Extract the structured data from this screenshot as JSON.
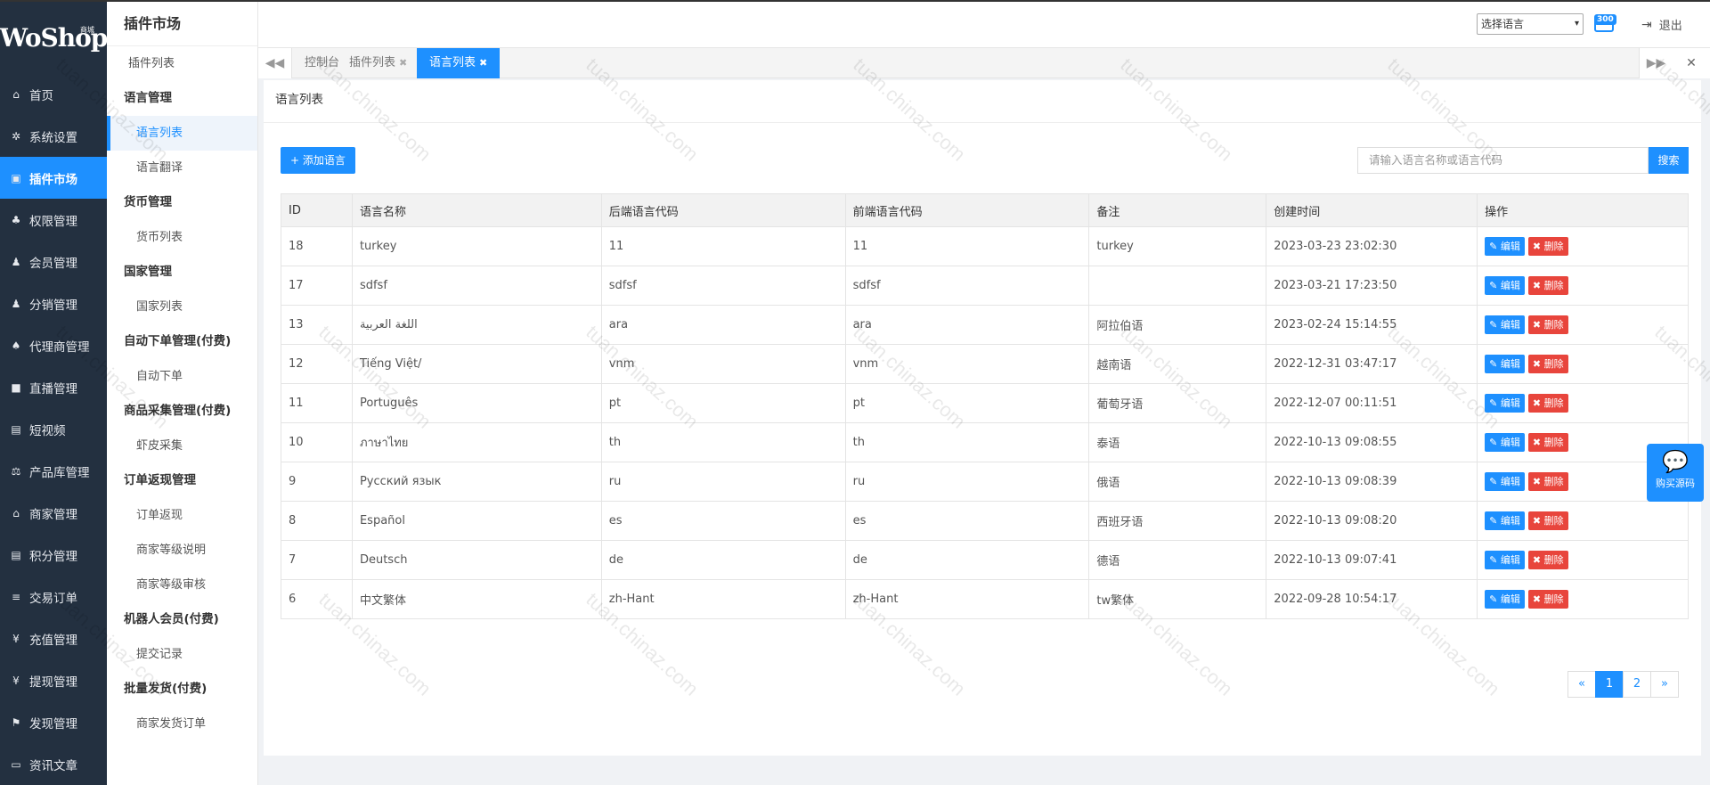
{
  "brand": {
    "logo_text": "WoShop",
    "logo_sub": "商城"
  },
  "nav": [
    {
      "label": "首页",
      "icon": "home-icon",
      "glyph": "⌂"
    },
    {
      "label": "系统设置",
      "icon": "gear-icon",
      "glyph": "✲"
    },
    {
      "label": "插件市场",
      "icon": "plugin-icon",
      "glyph": "▣"
    },
    {
      "label": "权限管理",
      "icon": "sitemap-icon",
      "glyph": "♣"
    },
    {
      "label": "会员管理",
      "icon": "users-icon",
      "glyph": "♟"
    },
    {
      "label": "分销管理",
      "icon": "users-icon",
      "glyph": "♟"
    },
    {
      "label": "代理商管理",
      "icon": "agents-icon",
      "glyph": "♠"
    },
    {
      "label": "直播管理",
      "icon": "video-icon",
      "glyph": "■"
    },
    {
      "label": "短视频",
      "icon": "file-icon",
      "glyph": "▤"
    },
    {
      "label": "产品库管理",
      "icon": "scale-icon",
      "glyph": "⚖"
    },
    {
      "label": "商家管理",
      "icon": "bank-icon",
      "glyph": "⌂"
    },
    {
      "label": "积分管理",
      "icon": "document-icon",
      "glyph": "▤"
    },
    {
      "label": "交易订单",
      "icon": "list-icon",
      "glyph": "≡"
    },
    {
      "label": "充值管理",
      "icon": "yen-icon",
      "glyph": "¥"
    },
    {
      "label": "提现管理",
      "icon": "yen-icon",
      "glyph": "¥"
    },
    {
      "label": "发现管理",
      "icon": "flag-icon",
      "glyph": "⚑"
    },
    {
      "label": "资讯文章",
      "icon": "news-icon",
      "glyph": "▭"
    }
  ],
  "subnav": {
    "title": "插件市场",
    "sections": [
      {
        "type": "item-first",
        "label": "插件列表"
      },
      {
        "type": "group",
        "label": "语言管理"
      },
      {
        "type": "item",
        "label": "语言列表",
        "active": true
      },
      {
        "type": "item",
        "label": "语言翻译"
      },
      {
        "type": "group",
        "label": "货币管理"
      },
      {
        "type": "item",
        "label": "货币列表"
      },
      {
        "type": "group",
        "label": "国家管理"
      },
      {
        "type": "item",
        "label": "国家列表"
      },
      {
        "type": "group",
        "label": "自动下单管理(付费)"
      },
      {
        "type": "item",
        "label": "自动下单"
      },
      {
        "type": "group",
        "label": "商品采集管理(付费)"
      },
      {
        "type": "item",
        "label": "虾皮采集"
      },
      {
        "type": "group",
        "label": "订单返现管理"
      },
      {
        "type": "item",
        "label": "订单返现"
      },
      {
        "type": "item",
        "label": "商家等级说明"
      },
      {
        "type": "item",
        "label": "商家等级审核"
      },
      {
        "type": "group",
        "label": "机器人会员(付费)"
      },
      {
        "type": "item",
        "label": "提交记录"
      },
      {
        "type": "group",
        "label": "批量发货(付费)"
      },
      {
        "type": "item",
        "label": "商家发货订单"
      }
    ]
  },
  "header": {
    "language_select": "选择语言",
    "badge": "300",
    "logout": "退出"
  },
  "tabs": [
    {
      "label": "控制台",
      "closable": false
    },
    {
      "label": "插件列表",
      "closable": true
    },
    {
      "label": "语言列表",
      "closable": true,
      "active": true
    }
  ],
  "page": {
    "title": "语言列表",
    "add_button": "添加语言",
    "search_placeholder": "请输入语言名称或语言代码",
    "search_button": "搜索"
  },
  "table": {
    "headers": [
      "ID",
      "语言名称",
      "后端语言代码",
      "前端语言代码",
      "备注",
      "创建时间",
      "操作"
    ],
    "edit_label": "编辑",
    "delete_label": "删除",
    "rows": [
      [
        "18",
        "turkey",
        "11",
        "11",
        "turkey",
        "2023-03-23 23:02:30"
      ],
      [
        "17",
        "sdfsf",
        "sdfsf",
        "sdfsf",
        "",
        "2023-03-21 17:23:50"
      ],
      [
        "13",
        "اللغة العربية",
        "ara",
        "ara",
        "阿拉伯语",
        "2023-02-24 15:14:55"
      ],
      [
        "12",
        "Tiếng Việt/",
        "vnm",
        "vnm",
        "越南语",
        "2022-12-31 03:47:17"
      ],
      [
        "11",
        "Português",
        "pt",
        "pt",
        "葡萄牙语",
        "2022-12-07 00:11:51"
      ],
      [
        "10",
        "ภาษาไทย",
        "th",
        "th",
        "泰语",
        "2022-10-13 09:08:55"
      ],
      [
        "9",
        "Русский язык",
        "ru",
        "ru",
        "俄语",
        "2022-10-13 09:08:39"
      ],
      [
        "8",
        "Español",
        "es",
        "es",
        "西班牙语",
        "2022-10-13 09:08:20"
      ],
      [
        "7",
        "Deutsch",
        "de",
        "de",
        "德语",
        "2022-10-13 09:07:41"
      ],
      [
        "6",
        "中文繁体",
        "zh-Hant",
        "zh-Hant",
        "tw繁体",
        "2022-09-28 10:54:17"
      ]
    ]
  },
  "pagination": {
    "prev": "«",
    "pages": [
      "1",
      "2"
    ],
    "current": "1",
    "next": "»"
  },
  "float_button": {
    "label": "购买源码"
  },
  "watermark": {
    "text": "tuan.chinaz.com"
  },
  "colors": {
    "primary": "#1e90ff",
    "sidebar": "#233040",
    "danger": "#e8453c"
  }
}
